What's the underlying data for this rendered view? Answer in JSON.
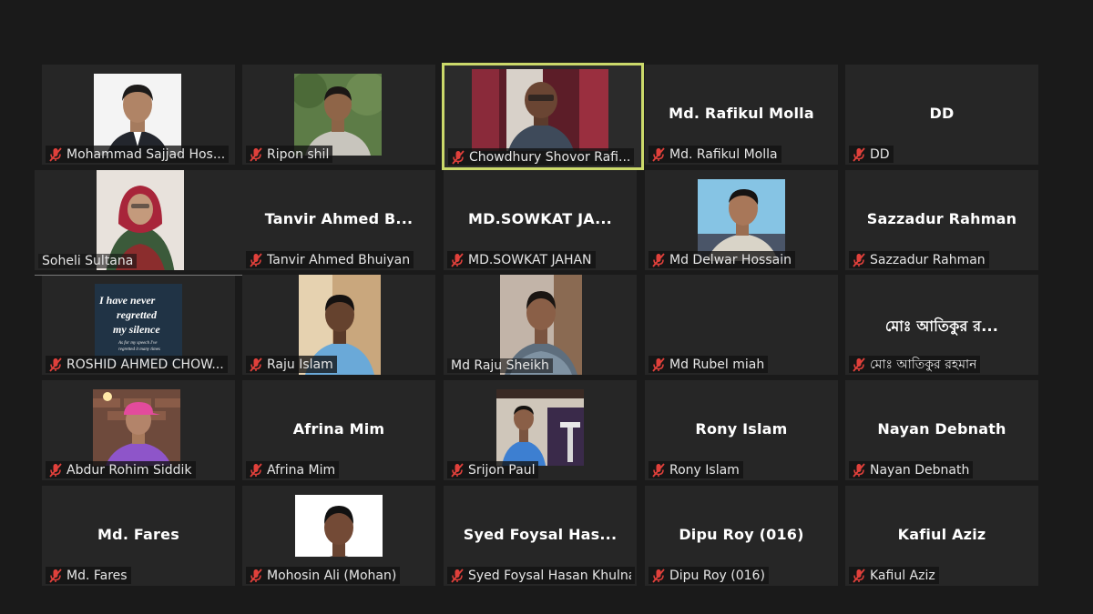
{
  "participants": [
    {
      "tile": "Mohammad Sajjad Hos...",
      "video": "photo-formal-man",
      "muted": true
    },
    {
      "tile": "Ripon shil",
      "video": "photo-young-man-trees",
      "muted": true
    },
    {
      "tile": "Chowdhury Shovor Rafi...",
      "video": "video-man-curtains",
      "muted": true,
      "active": true
    },
    {
      "tile": "Md. Rafikul Molla",
      "center": "Md. Rafikul Molla",
      "muted": true
    },
    {
      "tile": "DD",
      "center": "DD",
      "muted": true
    },
    {
      "tile": "Soheli Sultana",
      "video": "photo-woman-hijab",
      "muted": false
    },
    {
      "tile": "Tanvir Ahmed Bhuiyan",
      "center": "Tanvir Ahmed B...",
      "muted": true
    },
    {
      "tile": "MD.SOWKAT JAHAN",
      "center": "MD.SOWKAT JA...",
      "muted": true
    },
    {
      "tile": "Md Delwar Hossain",
      "video": "photo-selfie-man",
      "muted": true
    },
    {
      "tile": "Sazzadur Rahman",
      "center": "Sazzadur Rahman",
      "muted": true
    },
    {
      "tile": "ROSHID AHMED CHOW...",
      "video": "quote-image",
      "muted": true
    },
    {
      "tile": "Raju Islam",
      "video": "photo-man-outdoor",
      "muted": true
    },
    {
      "tile": "Md Raju Sheikh",
      "video": "photo-man-cap",
      "muted": false
    },
    {
      "tile": "Md Rubel miah",
      "muted": true
    },
    {
      "tile": "মোঃ আতিকুর রহমান",
      "center": "মোঃ আতিকুর র...",
      "muted": true
    },
    {
      "tile": "Abdur Rohim Siddik",
      "video": "photo-man-cap-pink",
      "muted": true
    },
    {
      "tile": "Afrina Mim",
      "center": "Afrina Mim",
      "muted": true
    },
    {
      "tile": "Srijon Paul",
      "video": "photo-speaker-podium",
      "muted": true
    },
    {
      "tile": "Rony Islam",
      "center": "Rony Islam",
      "muted": true
    },
    {
      "tile": "Nayan Debnath",
      "center": "Nayan Debnath",
      "muted": true
    },
    {
      "tile": "Md. Fares",
      "center": "Md. Fares",
      "muted": true
    },
    {
      "tile": "Mohosin Ali (Mohan)",
      "video": "photo-man-white-bg",
      "muted": true
    },
    {
      "tile": "Syed Foysal Hasan Khulna",
      "center": "Syed Foysal Has...",
      "muted": true
    },
    {
      "tile": "Dipu Roy (016)",
      "center": "Dipu Roy (016)",
      "muted": true
    },
    {
      "tile": "Kafiul Aziz",
      "center": "Kafiul Aziz",
      "muted": true
    }
  ],
  "quote": {
    "line1": "I have never",
    "line2": "regretted",
    "line3": "my silence",
    "small": "As for my speech I've regretted it many times"
  },
  "colors": {
    "background": "#1a1a1a",
    "tile": "#262626",
    "active_border": "#cbd96a",
    "muted_icon": "#e0403b"
  },
  "icons": {
    "muted": "mic-muted-icon"
  }
}
